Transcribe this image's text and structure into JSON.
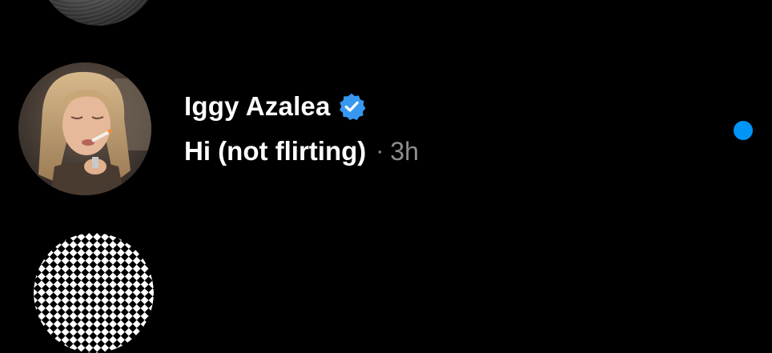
{
  "conversation": {
    "name": "Iggy Azalea",
    "verified": true,
    "message_preview": "Hi (not flirting)",
    "separator": "·",
    "time_ago": "3h",
    "unread": true
  },
  "colors": {
    "background": "#000000",
    "text_primary": "#ffffff",
    "text_secondary": "#8e8e8e",
    "verified_badge": "#3897f0",
    "unread_dot": "#0095f6"
  },
  "icons": {
    "verified": "verified-badge-icon"
  }
}
